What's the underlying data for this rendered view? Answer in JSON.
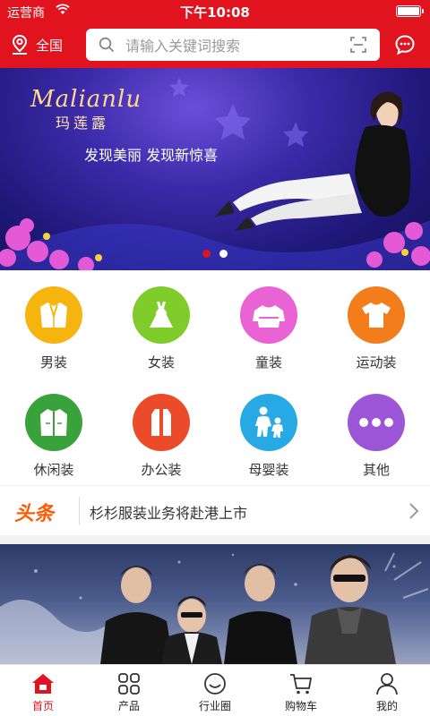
{
  "status_bar": {
    "carrier": "运营商",
    "time": "下午10:08"
  },
  "header": {
    "location": "全国",
    "search_placeholder": "请输入关键词搜索",
    "icons": [
      "location-icon",
      "search-icon",
      "scan-icon",
      "message-icon"
    ]
  },
  "banner": {
    "brand": "Malianlu",
    "brand_cn": "玛莲露",
    "slogan": "发现美丽 发现新惊喜",
    "slide_count": 2,
    "active_slide": 1
  },
  "categories": [
    {
      "label": "男装",
      "icon": "suit-icon",
      "color": "#f6b40f"
    },
    {
      "label": "女装",
      "icon": "dress-icon",
      "color": "#7fcb2a"
    },
    {
      "label": "童装",
      "icon": "kids-sweater-icon",
      "color": "#ea63d4"
    },
    {
      "label": "运动装",
      "icon": "tshirt-icon",
      "color": "#f37d1b"
    },
    {
      "label": "休闲装",
      "icon": "jacket-icon",
      "color": "#3aa23a"
    },
    {
      "label": "办公装",
      "icon": "office-coat-icon",
      "color": "#ec4b2b"
    },
    {
      "label": "母婴装",
      "icon": "mother-baby-icon",
      "color": "#27a9e6"
    },
    {
      "label": "其他",
      "icon": "more-dots-icon",
      "color": "#9b55d6"
    }
  ],
  "news": {
    "tag": "头条",
    "headline": "杉杉服装业务将赴港上市"
  },
  "tabbar": [
    {
      "label": "首页",
      "icon": "home-icon",
      "active": true
    },
    {
      "label": "产品",
      "icon": "grid-icon",
      "active": false
    },
    {
      "label": "行业圈",
      "icon": "circle-icon",
      "active": false
    },
    {
      "label": "购物车",
      "icon": "cart-icon",
      "active": false
    },
    {
      "label": "我的",
      "icon": "user-icon",
      "active": false
    }
  ],
  "colors": {
    "brand_red": "#e1131e",
    "headline_orange": "#ff5a00"
  }
}
